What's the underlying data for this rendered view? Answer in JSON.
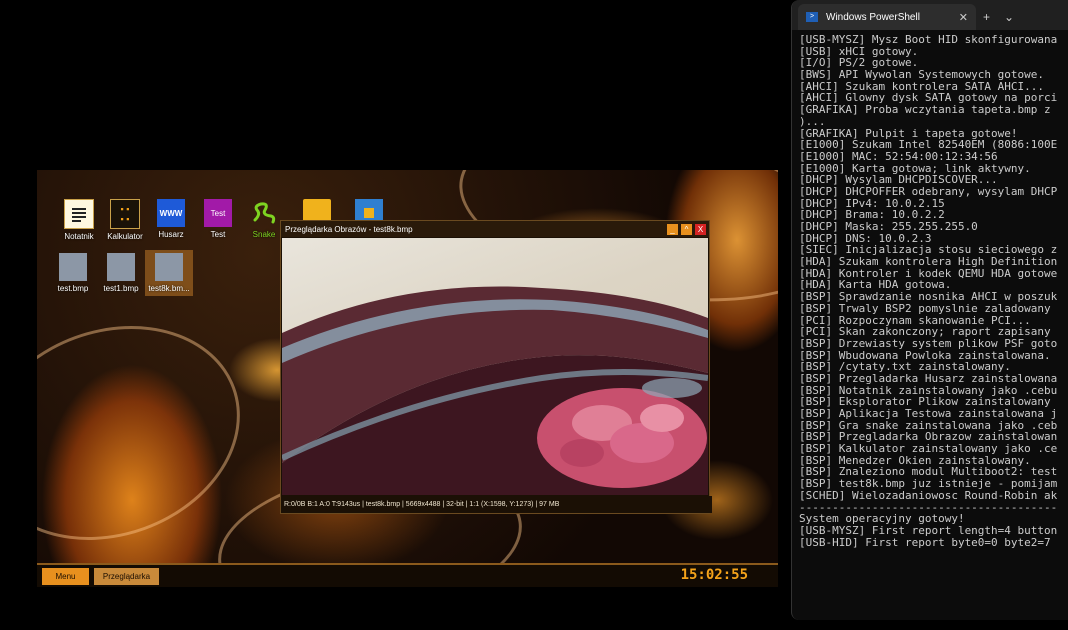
{
  "vm": {
    "desktop_icons": [
      {
        "name": "Notatnik",
        "icon": "notepad-icon"
      },
      {
        "name": "Kalkulator",
        "icon": "calculator-icon"
      },
      {
        "name": "Husarz",
        "icon": "husarz-icon",
        "glyph": "WWW"
      },
      {
        "name": "Test",
        "icon": "test-app-icon",
        "glyph": "Test"
      },
      {
        "name": "Snake",
        "icon": "snake-icon"
      },
      {
        "name": "",
        "icon": "folder-icon"
      },
      {
        "name": "",
        "icon": "file-manager-icon"
      },
      {
        "name": "test.bmp",
        "icon": "bmp-file-icon"
      },
      {
        "name": "test1.bmp",
        "icon": "bmp-file-icon"
      },
      {
        "name": "test8k.bm...",
        "icon": "bmp-file-icon"
      }
    ],
    "viewer": {
      "title": "Przeglądarka Obrazów - test8k.bmp",
      "minimize": "_",
      "maximize": "^",
      "close": "X",
      "status": "R:0/0B B:1 A:0 T:9143us | test8k.bmp | 5669x4488 | 32-bit | 1:1 (X:1598, Y:1273) | 97 MB"
    },
    "taskbar": {
      "menu_label": "Menu",
      "app_label": "Przeglądarka",
      "clock": "15:02:55"
    },
    "colors": {
      "accent": "#f5a31a",
      "taskbar_button": "#e8901e"
    }
  },
  "powershell": {
    "tab_title": "Windows PowerShell",
    "close_glyph": "✕",
    "new_tab_glyph": "+",
    "dropdown_glyph": "⌄",
    "lines": [
      "[USB-MYSZ] Mysz Boot HID skonfigurowana",
      "[USB] xHCI gotowy.",
      "[I/O] PS/2 gotowe.",
      "[BWS] API Wywolan Systemowych gotowe.",
      "[AHCI] Szukam kontrolera SATA AHCI...",
      "[AHCI] Glowny dysk SATA gotowy na porci",
      "[GRAFIKA] Proba wczytania tapeta.bmp z",
      ")...",
      "[GRAFIKA] Pulpit i tapeta gotowe!",
      "[E1000] Szukam Intel 82540EM (8086:100E",
      "[E1000] MAC: 52:54:00:12:34:56",
      "[E1000] Karta gotowa; link aktywny.",
      "[DHCP] Wysylam DHCPDISCOVER...",
      "[DHCP] DHCPOFFER odebrany, wysylam DHCP",
      "[DHCP] IPv4: 10.0.2.15",
      "[DHCP] Brama: 10.0.2.2",
      "[DHCP] Maska: 255.255.255.0",
      "[DHCP] DNS: 10.0.2.3",
      "[SIEC] Inicjalizacja stosu sieciowego z",
      "[HDA] Szukam kontrolera High Definition",
      "[HDA] Kontroler i kodek QEMU HDA gotowe",
      "[HDA] Karta HDA gotowa.",
      "[BSP] Sprawdzanie nosnika AHCI w poszuk",
      "[BSP] Trwaly BSP2 pomyslnie zaladowany",
      "[PCI] Rozpoczynam skanowanie PCI...",
      "[PCI] Skan zakonczony; raport zapisany",
      "[BSP] Drzewiasty system plikow PSF goto",
      "[BSP] Wbudowana Powloka zainstalowana.",
      "[BSP] /cytaty.txt zainstalowany.",
      "[BSP] Przegladarka Husarz zainstalowana",
      "[BSP] Notatnik zainstalowany jako .cebu",
      "[BSP] Eksplorator Plikow zainstalowany",
      "[BSP] Aplikacja Testowa zainstalowana j",
      "[BSP] Gra snake zainstalowana jako .ceb",
      "[BSP] Przegladarka Obrazow zainstalowan",
      "[BSP] Kalkulator zainstalowany jako .ce",
      "[BSP] Menedzer Okien zainstalowany.",
      "[BSP] Znaleziono modul Multiboot2: test",
      "[BSP] test8k.bmp juz istnieje - pomijam",
      "[SCHED] Wielozadaniowosc Round-Robin ak",
      "---------------------------------------",
      "System operacyjny gotowy!",
      "[USB-MYSZ] First report length=4 button",
      "[USB-HID] First report byte0=0 byte2=7"
    ]
  }
}
